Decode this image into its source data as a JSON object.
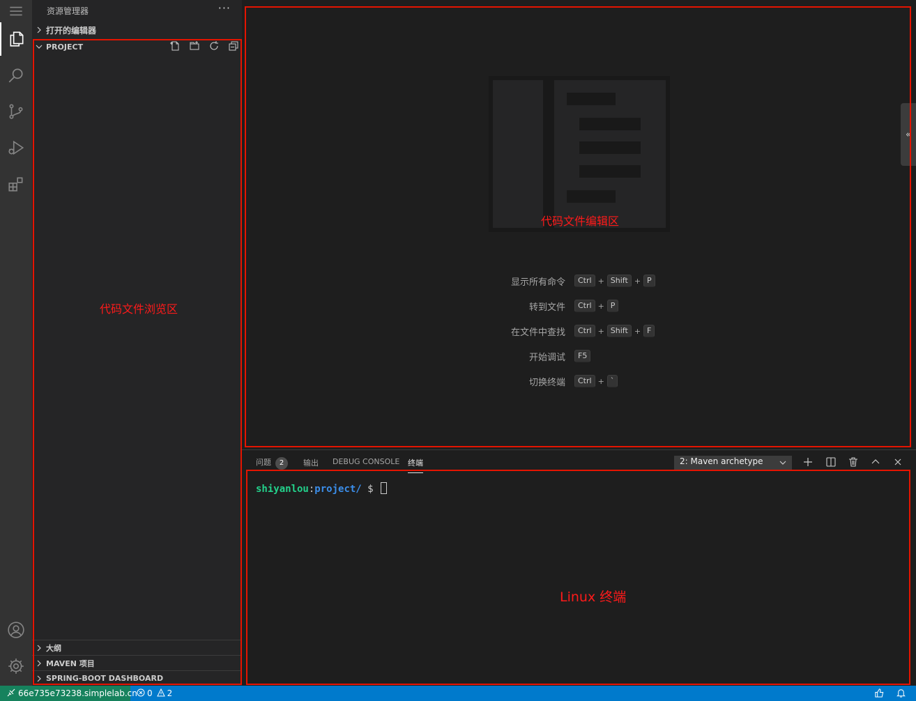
{
  "activity_bar": {
    "icons": [
      "menu-icon",
      "explorer-icon",
      "search-icon",
      "source-control-icon",
      "run-debug-icon",
      "extensions-icon",
      "account-icon",
      "settings-gear-icon"
    ]
  },
  "sidebar": {
    "title": "资源管理器",
    "more": "···",
    "open_editors": "打开的编辑器",
    "project": "PROJECT",
    "outline": "大纲",
    "maven": "MAVEN 项目",
    "spring": "SPRING-BOOT DASHBOARD"
  },
  "annotations": {
    "browser": "代码文件浏览区",
    "editor": "代码文件编辑区",
    "terminal": "Linux 终端"
  },
  "editor": {
    "shortcuts": [
      {
        "label": "显示所有命令",
        "keys": [
          "Ctrl",
          "Shift",
          "P"
        ]
      },
      {
        "label": "转到文件",
        "keys": [
          "Ctrl",
          "P"
        ]
      },
      {
        "label": "在文件中查找",
        "keys": [
          "Ctrl",
          "Shift",
          "F"
        ]
      },
      {
        "label": "开始调试",
        "keys": [
          "F5"
        ]
      },
      {
        "label": "切换终端",
        "keys": [
          "Ctrl",
          "`"
        ]
      }
    ],
    "collapse_glyph": "«"
  },
  "panel": {
    "tabs": {
      "problems": "问题",
      "problems_count": "2",
      "output": "输出",
      "debug": "DEBUG CONSOLE",
      "terminal": "终端"
    },
    "terminal_select": "2: Maven archetype",
    "prompt": {
      "user": "shiyanlou",
      "sep": ":",
      "path": "project/",
      "dollar": " $ "
    }
  },
  "statusbar": {
    "remote": "66e735e73238.simplelab.cn",
    "errors": "0",
    "warnings": "2"
  },
  "colors": {
    "accent": "#007acc",
    "remote": "#16825d",
    "annotation": "#e51400"
  }
}
